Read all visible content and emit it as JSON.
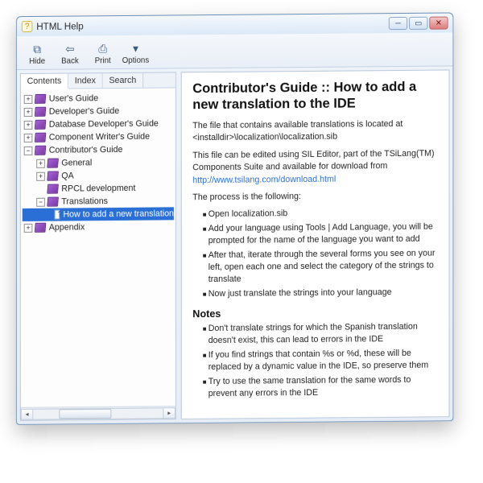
{
  "window": {
    "title": "HTML Help"
  },
  "toolbar": {
    "hide": "Hide",
    "back": "Back",
    "print": "Print",
    "options": "Options"
  },
  "tabs": {
    "contents": "Contents",
    "index": "Index",
    "search": "Search"
  },
  "tree": {
    "users_guide": "User's Guide",
    "dev_guide": "Developer's Guide",
    "db_dev_guide": "Database Developer's Guide",
    "comp_writer": "Component Writer's Guide",
    "contrib": "Contributor's Guide",
    "general": "General",
    "qa": "QA",
    "rpcl": "RPCL development",
    "translations": "Translations",
    "howto": "How to add a new translation",
    "appendix": "Appendix"
  },
  "content": {
    "heading": "Contributor's Guide :: How to add a new translation to the IDE",
    "p1a": "The file that contains available translations is located at ",
    "p1b": "<installdir>\\localization\\localization.sib",
    "p2a": "This file can be edited using SIL Editor, part of the TSiLang(TM) Components Suite and available for download from ",
    "p2link": "http://www.tsilang.com/download.html",
    "p3": "The process is the following:",
    "steps": {
      "s1": "Open localization.sib",
      "s2": "Add your language using Tools | Add Language, you will be prompted for the name of the language you want to add",
      "s3": "After that, iterate through the several forms you see on your left, open each one and select the category of the strings to translate",
      "s4": "Now just translate the strings into your language"
    },
    "notes_h": "Notes",
    "notes": {
      "n1": "Don't translate strings for which the Spanish translation doesn't exist, this can lead to errors in the IDE",
      "n2": "If you find strings that contain %s or %d, these will be replaced by a dynamic value in the IDE, so preserve them",
      "n3": "Try to use the same translation for the same words to prevent any errors in the IDE"
    }
  }
}
